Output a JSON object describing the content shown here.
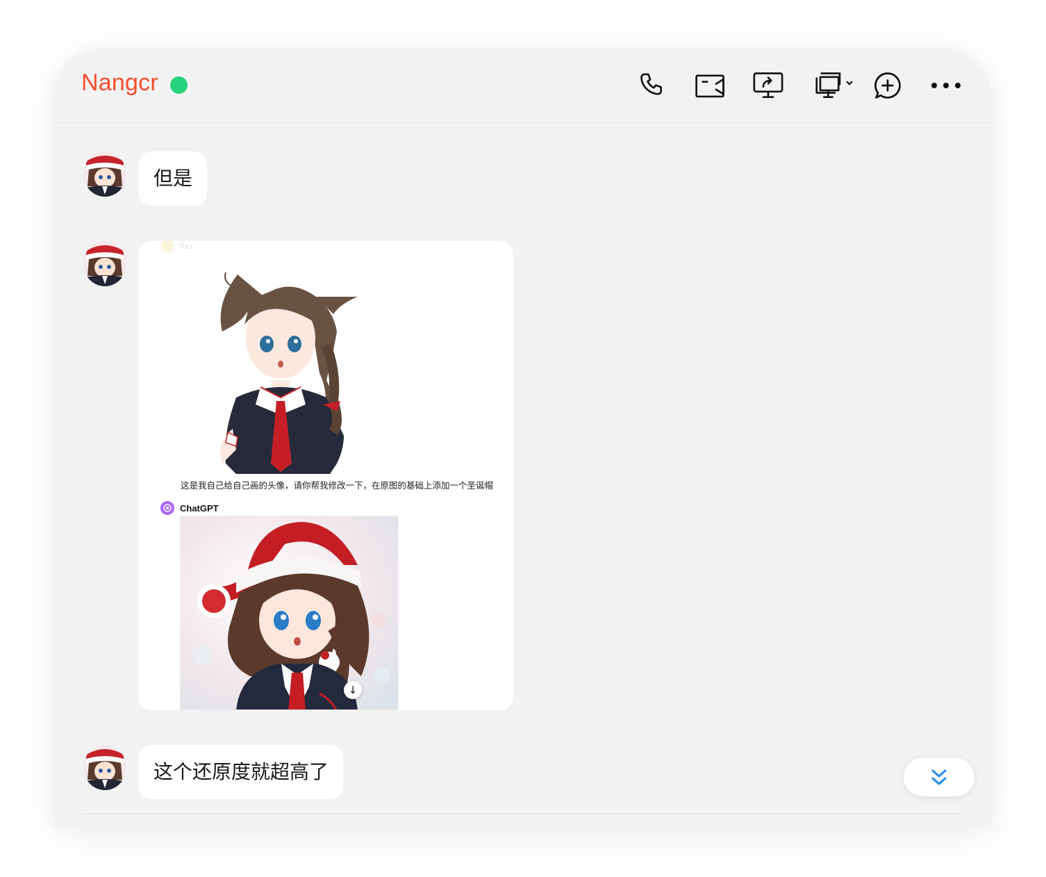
{
  "header": {
    "contact_name": "Nangcr",
    "status": "online",
    "status_color": "#26d27c",
    "name_color": "#f44d2b",
    "actions": [
      {
        "name": "voice-call",
        "icon": "phone-icon"
      },
      {
        "name": "video-call",
        "icon": "video-camera-icon"
      },
      {
        "name": "share-screen",
        "icon": "screen-share-icon"
      },
      {
        "name": "remote-desktop",
        "icon": "remote-screen-icon"
      },
      {
        "name": "add-chat",
        "icon": "chat-add-icon"
      },
      {
        "name": "more",
        "icon": "more-dots-icon"
      }
    ]
  },
  "messages": [
    {
      "type": "text",
      "text": "但是"
    },
    {
      "type": "image",
      "you_label": "You",
      "prompt": "这是我自己给自己画的头像，请你帮我修改一下，在原图的基础上添加一个圣诞帽",
      "assistant_name": "ChatGPT"
    },
    {
      "type": "text",
      "text": "这个还原度就超高了"
    }
  ],
  "scroll_button": {
    "icon": "double-chevron-down-icon"
  }
}
